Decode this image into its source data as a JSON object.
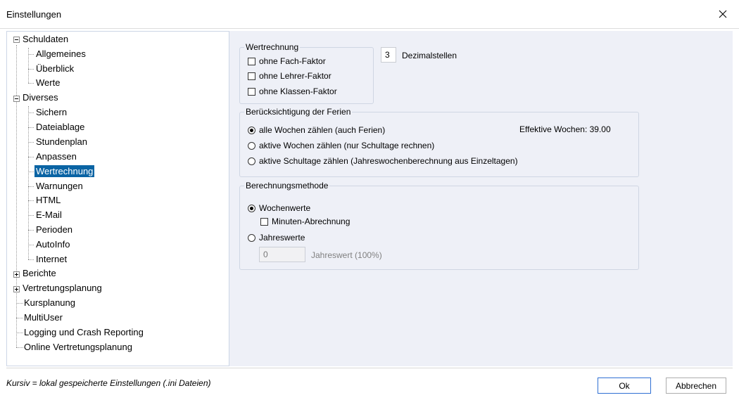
{
  "window": {
    "title": "Einstellungen"
  },
  "tree": {
    "schuldaten": "Schuldaten",
    "allgemeines": "Allgemeines",
    "ueberblick": "Überblick",
    "werte": "Werte",
    "diverses": "Diverses",
    "sichern": "Sichern",
    "dateiablage": "Dateiablage",
    "stundenplan": "Stundenplan",
    "anpassen": "Anpassen",
    "wertrechnung": "Wertrechnung",
    "warnungen": "Warnungen",
    "html": "HTML",
    "email": "E-Mail",
    "perioden": "Perioden",
    "autoinfo": "AutoInfo",
    "internet": "Internet",
    "berichte": "Berichte",
    "vertretungsplanung": "Vertretungsplanung",
    "kursplanung": "Kursplanung",
    "multiuser": "MultiUser",
    "logging": "Logging und Crash Reporting",
    "online": "Online Vertretungsplanung"
  },
  "wertrechnung": {
    "legend": "Wertrechnung",
    "fach": "ohne Fach-Faktor",
    "lehrer": "ohne Lehrer-Faktor",
    "klassen": "ohne Klassen-Faktor",
    "decimals_value": "3",
    "decimals_label": "Dezimalstellen"
  },
  "ferien": {
    "legend": "Berücksichtigung der Ferien",
    "opt1": "alle Wochen zählen (auch Ferien)",
    "opt2": "aktive Wochen zählen (nur Schultage rechnen)",
    "opt3": "aktive Schultage zählen (Jahreswochenberechnung aus Einzeltagen)",
    "effektiv": "Effektive Wochen: 39.00"
  },
  "methode": {
    "legend": "Berechnungsmethode",
    "wochenwerte": "Wochenwerte",
    "minuten": "Minuten-Abrechnung",
    "jahreswerte": "Jahreswerte",
    "jahreswert_value": "0",
    "jahreswert_label": "Jahreswert (100%)"
  },
  "footer": {
    "hint": "Kursiv = lokal gespeicherte Einstellungen (.ini Dateien)",
    "ok": "Ok",
    "cancel": "Abbrechen"
  }
}
